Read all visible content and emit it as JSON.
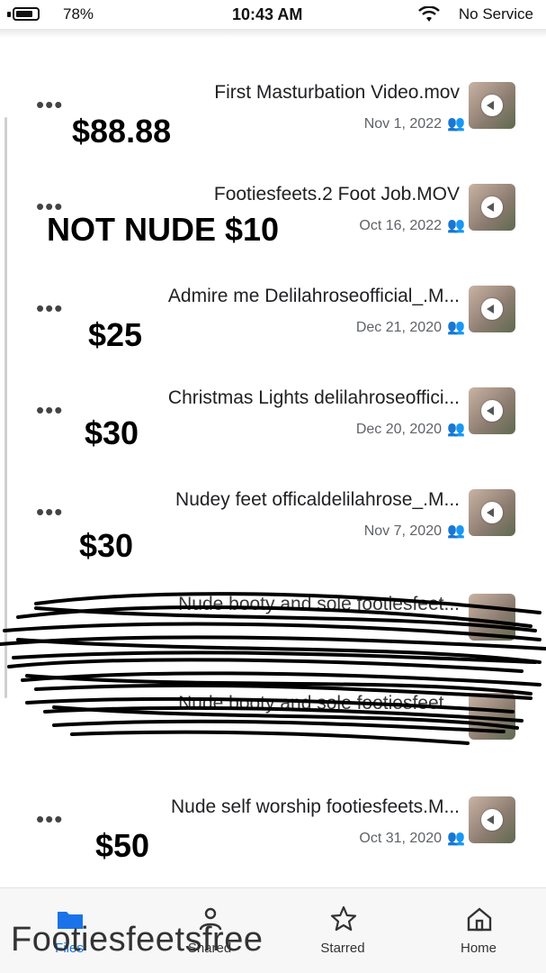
{
  "status_bar": {
    "carrier": "No Service",
    "time": "10:43 AM",
    "battery": "78%"
  },
  "files": [
    {
      "name": "First Masturbation Video.mov",
      "date": "Nov 1, 2022",
      "price": "$88.88"
    },
    {
      "name": "Footiesfeets.2 Foot Job.MOV",
      "date": "Oct 16, 2022",
      "price": "NOT NUDE $10"
    },
    {
      "name": "Admire me Delilahroseofficial_.M...",
      "date": "Dec 21, 2020",
      "price": "$25"
    },
    {
      "name": "Christmas Lights delilahroseoffici...",
      "date": "Dec 20, 2020",
      "price": "$30"
    },
    {
      "name": "Nudey feet officaldelilahrose_.M...",
      "date": "Nov 7, 2020",
      "price": "$30"
    },
    {
      "name": "Nude self worship footiesfeets.M...",
      "date": "Oct 31, 2020",
      "price": "$50"
    }
  ],
  "redacted": [
    {
      "name": "Nude booty and sole footiesfeet..."
    },
    {
      "name": "Nude booty and sole footiesfeet..."
    }
  ],
  "nav": {
    "home": "Home",
    "starred": "Starred",
    "shared": "Shared",
    "files": "Files"
  },
  "watermark": "Footiesfeetsfree",
  "colors": {
    "accent": "#1a73e8",
    "text": "#202124",
    "meta": "#5f6368"
  }
}
